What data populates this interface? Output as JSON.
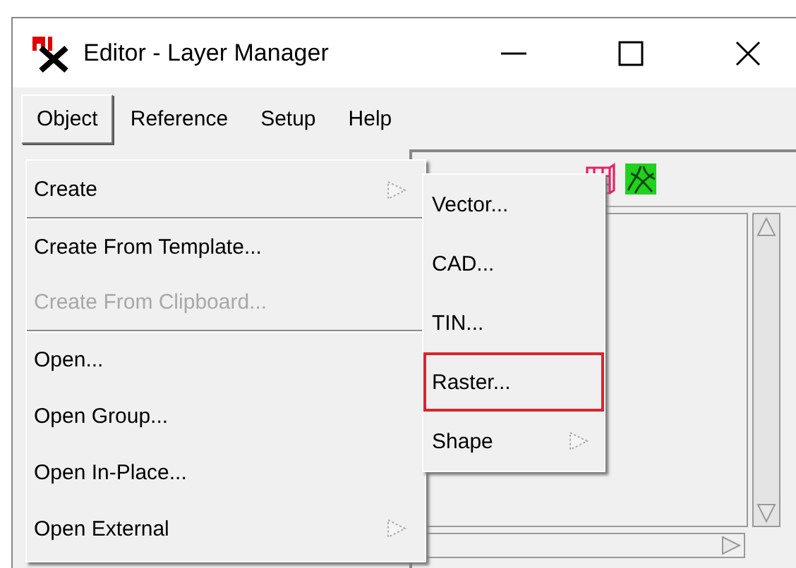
{
  "window": {
    "title": "Editor - Layer Manager"
  },
  "menu_bar": [
    {
      "label": "Object",
      "selected": true
    },
    {
      "label": "Reference",
      "selected": false
    },
    {
      "label": "Setup",
      "selected": false
    },
    {
      "label": "Help",
      "selected": false
    }
  ],
  "object_menu": [
    {
      "label": "Create",
      "has_submenu": true,
      "disabled": false,
      "separator_after": true
    },
    {
      "label": "Create From Template...",
      "has_submenu": false,
      "disabled": false,
      "separator_after": false
    },
    {
      "label": "Create From Clipboard...",
      "has_submenu": false,
      "disabled": true,
      "separator_after": true
    },
    {
      "label": "Open...",
      "has_submenu": false,
      "disabled": false,
      "separator_after": false
    },
    {
      "label": "Open Group...",
      "has_submenu": false,
      "disabled": false,
      "separator_after": false
    },
    {
      "label": "Open In-Place...",
      "has_submenu": false,
      "disabled": false,
      "separator_after": false
    },
    {
      "label": "Open External",
      "has_submenu": true,
      "disabled": false,
      "separator_after": false
    }
  ],
  "create_submenu": [
    {
      "label": "Vector...",
      "has_submenu": false,
      "marked": false
    },
    {
      "label": "CAD...",
      "has_submenu": false,
      "marked": false
    },
    {
      "label": "TIN...",
      "has_submenu": false,
      "marked": false
    },
    {
      "label": "Raster...",
      "has_submenu": false,
      "marked": true
    },
    {
      "label": "Shape",
      "has_submenu": true,
      "marked": false
    }
  ]
}
